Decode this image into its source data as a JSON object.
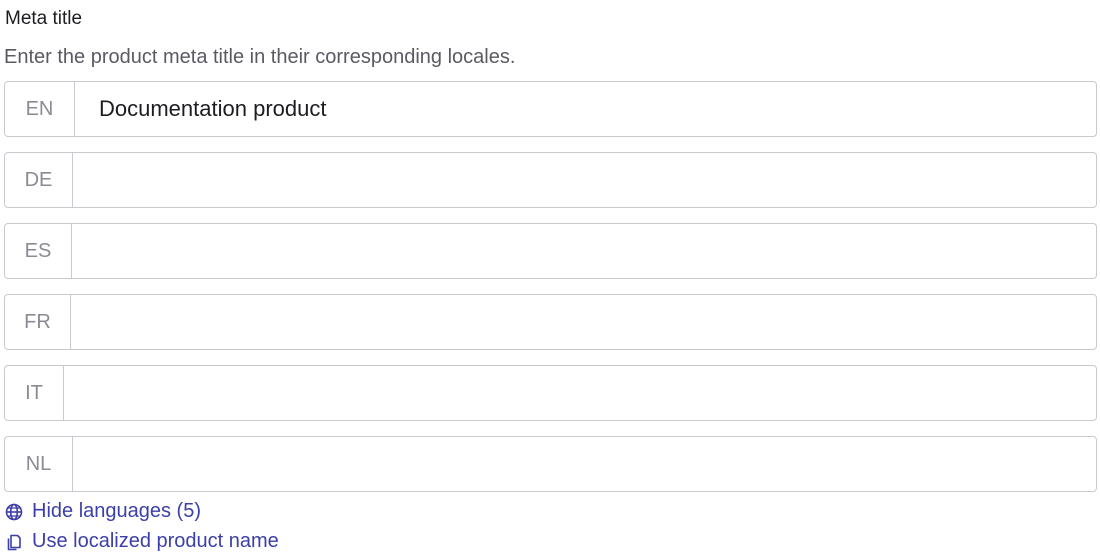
{
  "meta_title": {
    "label": "Meta title",
    "help": "Enter the product meta title in their corresponding locales.",
    "locales": [
      {
        "code": "EN",
        "value": "Documentation product",
        "placeholder": ""
      },
      {
        "code": "DE",
        "value": "",
        "placeholder": ""
      },
      {
        "code": "ES",
        "value": "",
        "placeholder": ""
      },
      {
        "code": "FR",
        "value": "",
        "placeholder": ""
      },
      {
        "code": "IT",
        "value": "",
        "placeholder": ""
      },
      {
        "code": "NL",
        "value": "",
        "placeholder": ""
      }
    ]
  },
  "actions": {
    "hide_languages_label": "Hide languages (5)",
    "hide_languages_icon": "globe-icon",
    "use_localized_label": "Use localized product name",
    "use_localized_icon": "copy-icon"
  },
  "colors": {
    "link": "#3c3fa8",
    "border": "#c9c9cf",
    "locale_tag": "#8b8b93",
    "help_text": "#5a5a63"
  }
}
